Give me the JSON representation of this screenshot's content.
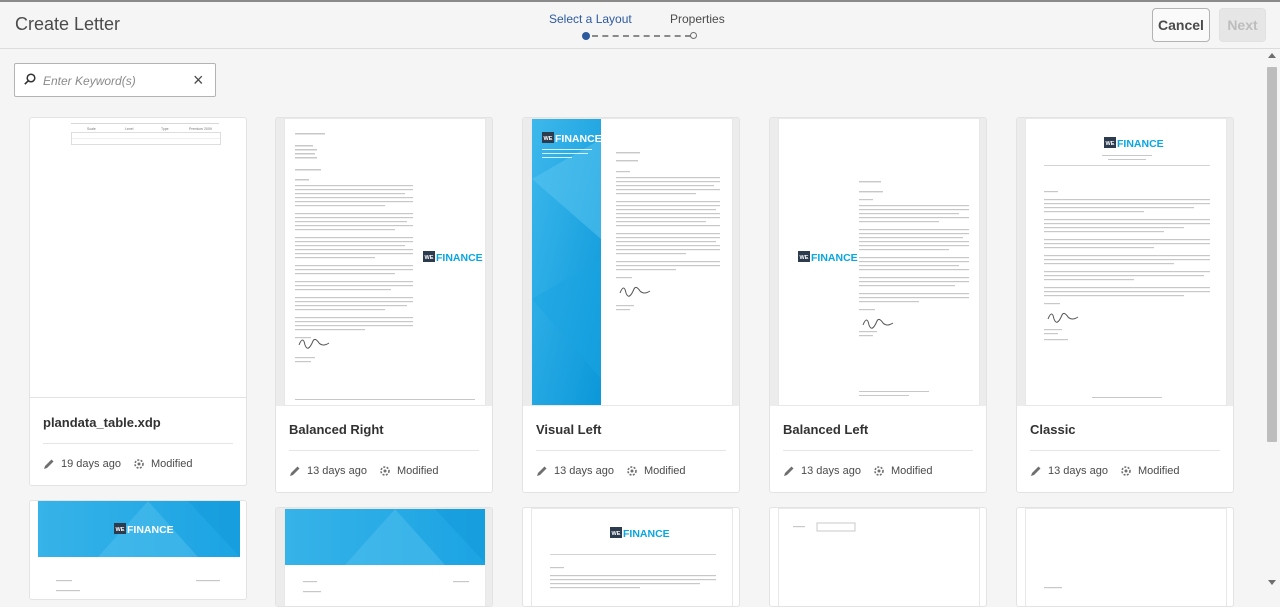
{
  "header": {
    "title": "Create Letter",
    "steps": [
      "Select a Layout",
      "Properties"
    ],
    "cancel_label": "Cancel",
    "next_label": "Next",
    "accent_color": "#2d5a9f"
  },
  "search": {
    "placeholder": "Enter Keyword(s)"
  },
  "cards": [
    {
      "name": "plandata_table.xdp",
      "age": "19 days ago",
      "status": "Modified"
    },
    {
      "name": "Balanced Right",
      "age": "13 days ago",
      "status": "Modified"
    },
    {
      "name": "Visual Left",
      "age": "13 days ago",
      "status": "Modified"
    },
    {
      "name": "Balanced Left",
      "age": "13 days ago",
      "status": "Modified"
    },
    {
      "name": "Classic",
      "age": "13 days ago",
      "status": "Modified"
    }
  ],
  "table_headers": [
    "Scale",
    "Level",
    "Type",
    "Premium 2009"
  ],
  "brand_text": "FINANCE",
  "brand_prefix": "WE",
  "icons": [
    "search-icon",
    "close-icon",
    "pencil-icon",
    "modified-icon"
  ]
}
